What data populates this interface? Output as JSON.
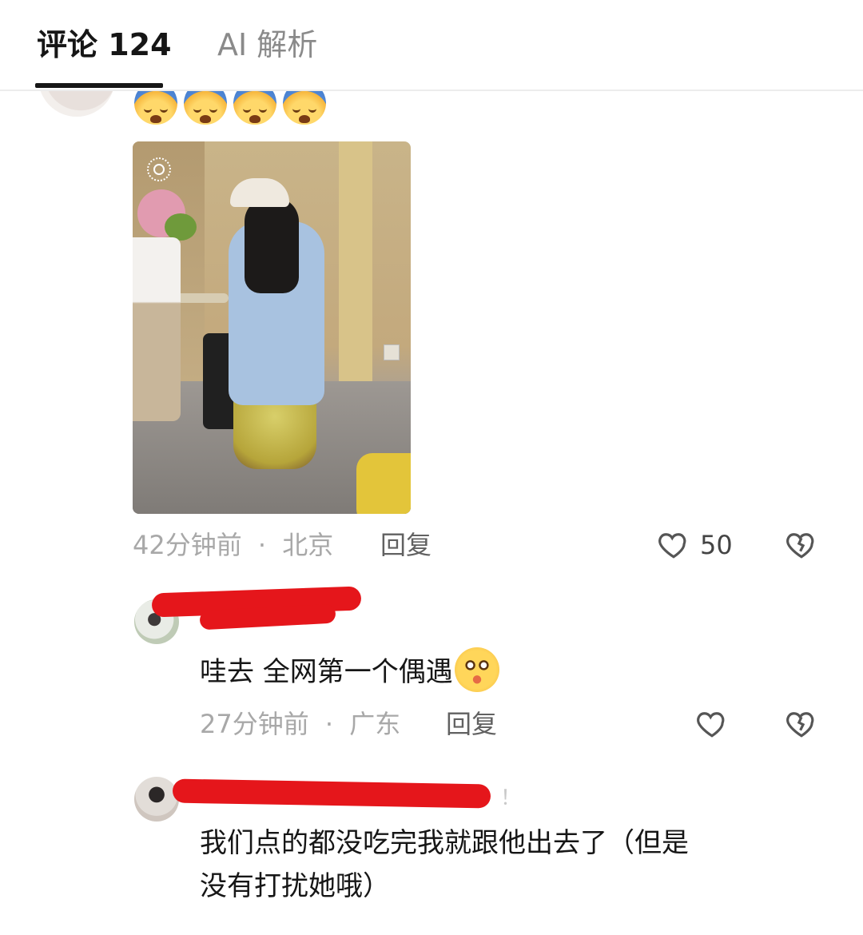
{
  "tabs": {
    "comments_label": "评论 124",
    "ai_label": "AI 解析"
  },
  "comment1": {
    "emoji_name": "crying-face",
    "time": "42分钟前",
    "location": "北京",
    "separator": "·",
    "reply_label": "回复",
    "like_count": "50"
  },
  "comment2": {
    "text": "哇去 全网第一个偶遇",
    "emoji_name": "pleading-face",
    "time": "27分钟前",
    "location": "广东",
    "separator": "·",
    "reply_label": "回复"
  },
  "comment3": {
    "text_line1": "我们点的都没吃完我就跟他出去了（但是",
    "text_line2": "没有打扰她哦）",
    "name_trailing": "！"
  },
  "colors": {
    "redaction": "#e5161b",
    "tab_active": "#161616",
    "meta_gray": "#a8a8a8"
  }
}
